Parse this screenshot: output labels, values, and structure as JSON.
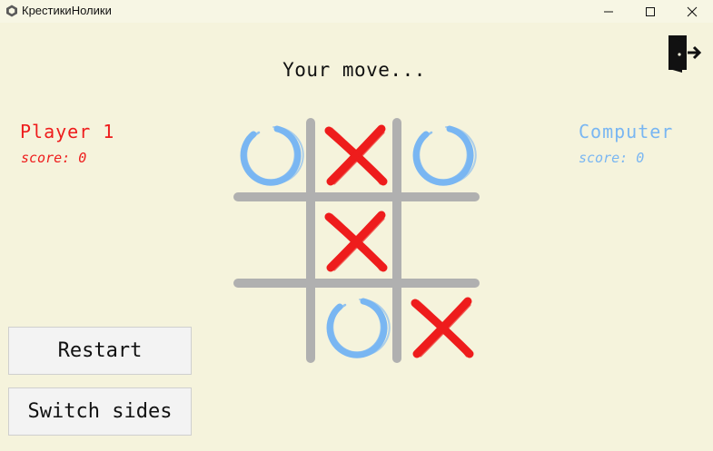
{
  "window": {
    "title": "КрестикиНолики",
    "icon": "app-icon",
    "controls": [
      "minimize-icon",
      "maximize-icon",
      "close-icon"
    ]
  },
  "game": {
    "status": "Your move...",
    "exit_icon": "exit-door-icon",
    "players": [
      {
        "name": "Player 1",
        "score_label": "score: 0",
        "mark": "X",
        "color": "#ee1c1c"
      },
      {
        "name": "Computer",
        "score_label": "score: 0",
        "mark": "O",
        "color": "#79b6f2"
      }
    ],
    "board": [
      "O",
      "X",
      "O",
      "",
      "X",
      "",
      "",
      "O",
      "X"
    ],
    "grid_color": "#b0b0b0",
    "background": "#f5f3dc"
  },
  "buttons": {
    "restart": "Restart",
    "switch_sides": "Switch sides"
  }
}
